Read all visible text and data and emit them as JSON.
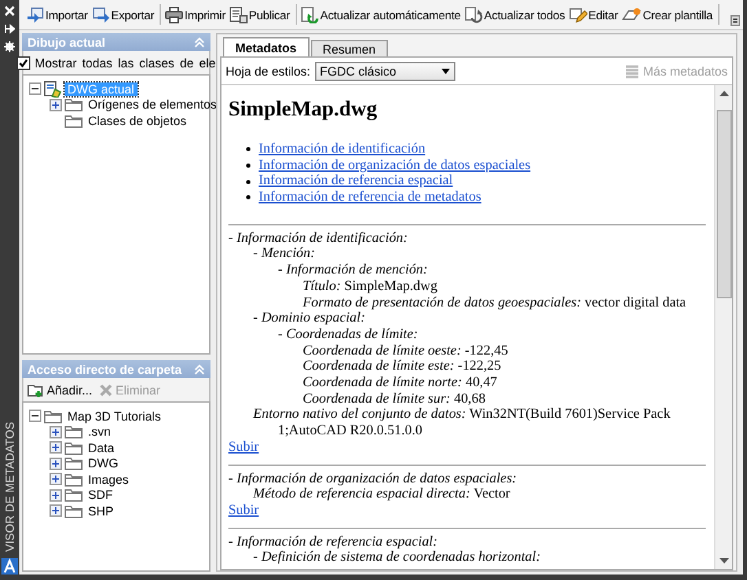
{
  "side_strip": {
    "title": "VISOR DE METADATOS"
  },
  "toolbar": {
    "groups": [
      [
        {
          "label": "Importar"
        },
        {
          "label": "Exportar"
        }
      ],
      [
        {
          "label": "Imprimir"
        },
        {
          "label": "Publicar"
        }
      ],
      [
        {
          "label": "Actualizar automáticamente"
        },
        {
          "label": "Actualizar todos"
        },
        {
          "label": "Editar"
        },
        {
          "label": "Crear plantilla"
        }
      ]
    ]
  },
  "drawing_panel": {
    "title": "Dibujo actual",
    "show_all": {
      "label": "Mostrar todas las clases de ele",
      "checked": true
    },
    "tree": [
      {
        "label": "DWG actual",
        "kind": "drawing",
        "selected": true,
        "expanded": true,
        "children": [
          {
            "label": "Orígenes de elementos",
            "kind": "folder",
            "selected": false,
            "expanded": false
          },
          {
            "label": "Clases de objetos",
            "kind": "folder",
            "selected": false
          }
        ]
      }
    ]
  },
  "folder_panel": {
    "title": "Acceso directo de carpeta",
    "actions": [
      {
        "label": "Añadir...",
        "disabled": false
      },
      {
        "label": "Eliminar",
        "disabled": true
      }
    ],
    "tree": [
      {
        "label": "Map 3D Tutorials",
        "kind": "folder",
        "selected": false,
        "expanded": true,
        "children": [
          {
            "label": ".svn",
            "kind": "folder",
            "selected": false,
            "expanded": false
          },
          {
            "label": "Data",
            "kind": "folder",
            "selected": false,
            "expanded": false
          },
          {
            "label": "DWG",
            "kind": "folder",
            "selected": false,
            "expanded": false
          },
          {
            "label": "Images",
            "kind": "folder",
            "selected": false,
            "expanded": false
          },
          {
            "label": "SDF",
            "kind": "folder",
            "selected": false,
            "expanded": false
          },
          {
            "label": "SHP",
            "kind": "folder",
            "selected": false,
            "expanded": false
          }
        ]
      }
    ]
  },
  "tabs": [
    {
      "label": "Metadatos",
      "selected": true
    },
    {
      "label": "Resumen",
      "selected": false
    }
  ],
  "stylesheet": {
    "label": "Hoja de estilos:",
    "value": "FGDC clásico"
  },
  "more_metadata": {
    "label": "Más metadatos",
    "disabled": true
  },
  "document": {
    "title": "SimpleMap.dwg",
    "links": [
      "Información de identificación",
      "Información de organización de datos espaciales",
      "Información de referencia espacial",
      "Información de referencia de metadatos"
    ],
    "sections": [
      {
        "entry": {
          "label": "- Información de identificación:",
          "children": [
            {
              "label": "- Mención:",
              "children": [
                {
                  "label": "- Información de mención:",
                  "children": [
                    {
                      "label": "Título:",
                      "value": "SimpleMap.dwg"
                    },
                    {
                      "label": "Formato de presentación de datos geoespaciales:",
                      "value": "vector digital data"
                    }
                  ]
                }
              ]
            },
            {
              "label": "- Dominio espacial:",
              "children": [
                {
                  "label": "- Coordenadas de límite:",
                  "children": [
                    {
                      "label": "Coordenada de límite oeste:",
                      "value": "-122,45"
                    },
                    {
                      "label": "Coordenada de límite este:",
                      "value": "-122,25"
                    },
                    {
                      "label": "Coordenada de límite norte:",
                      "value": "40,47"
                    },
                    {
                      "label": "Coordenada de límite sur:",
                      "value": "40,68"
                    }
                  ]
                }
              ]
            },
            {
              "label": "Entorno nativo del conjunto de datos:",
              "value": "Win32NT(Build 7601)Service Pack 1;AutoCAD R20.0.51.0.0"
            }
          ]
        },
        "up_link": "Subir"
      },
      {
        "entry": {
          "label": "- Información de organización de datos espaciales:",
          "children": [
            {
              "label": "Método de referencia espacial directa:",
              "value": "Vector"
            }
          ]
        },
        "up_link": "Subir"
      },
      {
        "entry": {
          "label": "- Información de referencia espacial:",
          "children": [
            {
              "label": "- Definición de sistema de coordenadas horizontal:"
            }
          ]
        }
      }
    ]
  }
}
